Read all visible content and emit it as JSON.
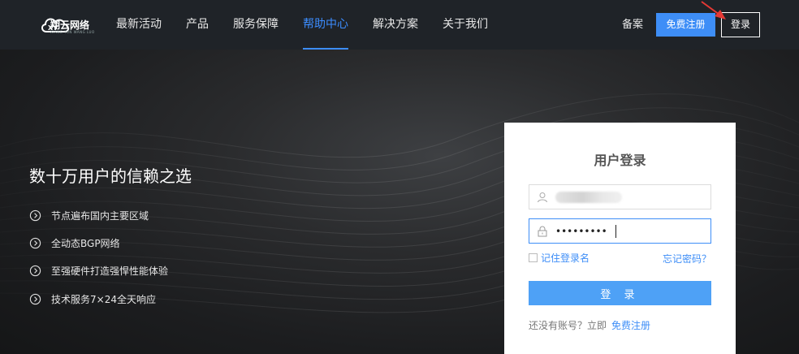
{
  "header": {
    "brand": "翔云网络",
    "brand_sub": "XIANG YUN WANG LUO",
    "nav": [
      {
        "label": "最新活动",
        "active": false
      },
      {
        "label": "产品",
        "active": false
      },
      {
        "label": "服务保障",
        "active": false
      },
      {
        "label": "帮助中心",
        "active": true
      },
      {
        "label": "解决方案",
        "active": false
      },
      {
        "label": "关于我们",
        "active": false
      }
    ],
    "beian": "备案",
    "register_button": "免费注册",
    "login_button": "登录"
  },
  "banner": {
    "slogan": "数十万用户的信赖之选",
    "features": [
      "节点遍布国内主要区域",
      "全动态BGP网络",
      "至强硬件打造强悍性能体验",
      "技术服务7×24全天响应"
    ]
  },
  "login": {
    "title": "用户登录",
    "username_value": "",
    "password_value": "•••••••••",
    "remember_label": "记住登录名",
    "forgot_label": "忘记密码？",
    "submit_label": "登 录",
    "no_account_text": "还没有账号？立即",
    "register_link": "免费注册"
  },
  "colors": {
    "accent": "#3e8ef7",
    "header_bg": "#1f2328",
    "nav_active": "#3c8dff"
  }
}
